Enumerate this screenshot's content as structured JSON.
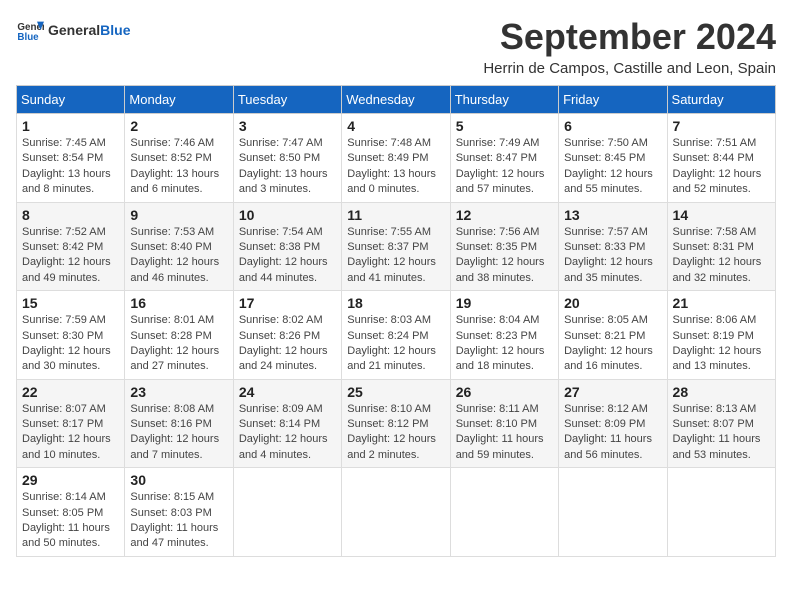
{
  "header": {
    "logo_general": "General",
    "logo_blue": "Blue",
    "month_title": "September 2024",
    "subtitle": "Herrin de Campos, Castille and Leon, Spain"
  },
  "weekdays": [
    "Sunday",
    "Monday",
    "Tuesday",
    "Wednesday",
    "Thursday",
    "Friday",
    "Saturday"
  ],
  "weeks": [
    [
      {
        "day": "1",
        "sunrise": "7:45 AM",
        "sunset": "8:54 PM",
        "daylight": "13 hours and 8 minutes."
      },
      {
        "day": "2",
        "sunrise": "7:46 AM",
        "sunset": "8:52 PM",
        "daylight": "13 hours and 6 minutes."
      },
      {
        "day": "3",
        "sunrise": "7:47 AM",
        "sunset": "8:50 PM",
        "daylight": "13 hours and 3 minutes."
      },
      {
        "day": "4",
        "sunrise": "7:48 AM",
        "sunset": "8:49 PM",
        "daylight": "13 hours and 0 minutes."
      },
      {
        "day": "5",
        "sunrise": "7:49 AM",
        "sunset": "8:47 PM",
        "daylight": "12 hours and 57 minutes."
      },
      {
        "day": "6",
        "sunrise": "7:50 AM",
        "sunset": "8:45 PM",
        "daylight": "12 hours and 55 minutes."
      },
      {
        "day": "7",
        "sunrise": "7:51 AM",
        "sunset": "8:44 PM",
        "daylight": "12 hours and 52 minutes."
      }
    ],
    [
      {
        "day": "8",
        "sunrise": "7:52 AM",
        "sunset": "8:42 PM",
        "daylight": "12 hours and 49 minutes."
      },
      {
        "day": "9",
        "sunrise": "7:53 AM",
        "sunset": "8:40 PM",
        "daylight": "12 hours and 46 minutes."
      },
      {
        "day": "10",
        "sunrise": "7:54 AM",
        "sunset": "8:38 PM",
        "daylight": "12 hours and 44 minutes."
      },
      {
        "day": "11",
        "sunrise": "7:55 AM",
        "sunset": "8:37 PM",
        "daylight": "12 hours and 41 minutes."
      },
      {
        "day": "12",
        "sunrise": "7:56 AM",
        "sunset": "8:35 PM",
        "daylight": "12 hours and 38 minutes."
      },
      {
        "day": "13",
        "sunrise": "7:57 AM",
        "sunset": "8:33 PM",
        "daylight": "12 hours and 35 minutes."
      },
      {
        "day": "14",
        "sunrise": "7:58 AM",
        "sunset": "8:31 PM",
        "daylight": "12 hours and 32 minutes."
      }
    ],
    [
      {
        "day": "15",
        "sunrise": "7:59 AM",
        "sunset": "8:30 PM",
        "daylight": "12 hours and 30 minutes."
      },
      {
        "day": "16",
        "sunrise": "8:01 AM",
        "sunset": "8:28 PM",
        "daylight": "12 hours and 27 minutes."
      },
      {
        "day": "17",
        "sunrise": "8:02 AM",
        "sunset": "8:26 PM",
        "daylight": "12 hours and 24 minutes."
      },
      {
        "day": "18",
        "sunrise": "8:03 AM",
        "sunset": "8:24 PM",
        "daylight": "12 hours and 21 minutes."
      },
      {
        "day": "19",
        "sunrise": "8:04 AM",
        "sunset": "8:23 PM",
        "daylight": "12 hours and 18 minutes."
      },
      {
        "day": "20",
        "sunrise": "8:05 AM",
        "sunset": "8:21 PM",
        "daylight": "12 hours and 16 minutes."
      },
      {
        "day": "21",
        "sunrise": "8:06 AM",
        "sunset": "8:19 PM",
        "daylight": "12 hours and 13 minutes."
      }
    ],
    [
      {
        "day": "22",
        "sunrise": "8:07 AM",
        "sunset": "8:17 PM",
        "daylight": "12 hours and 10 minutes."
      },
      {
        "day": "23",
        "sunrise": "8:08 AM",
        "sunset": "8:16 PM",
        "daylight": "12 hours and 7 minutes."
      },
      {
        "day": "24",
        "sunrise": "8:09 AM",
        "sunset": "8:14 PM",
        "daylight": "12 hours and 4 minutes."
      },
      {
        "day": "25",
        "sunrise": "8:10 AM",
        "sunset": "8:12 PM",
        "daylight": "12 hours and 2 minutes."
      },
      {
        "day": "26",
        "sunrise": "8:11 AM",
        "sunset": "8:10 PM",
        "daylight": "11 hours and 59 minutes."
      },
      {
        "day": "27",
        "sunrise": "8:12 AM",
        "sunset": "8:09 PM",
        "daylight": "11 hours and 56 minutes."
      },
      {
        "day": "28",
        "sunrise": "8:13 AM",
        "sunset": "8:07 PM",
        "daylight": "11 hours and 53 minutes."
      }
    ],
    [
      {
        "day": "29",
        "sunrise": "8:14 AM",
        "sunset": "8:05 PM",
        "daylight": "11 hours and 50 minutes."
      },
      {
        "day": "30",
        "sunrise": "8:15 AM",
        "sunset": "8:03 PM",
        "daylight": "11 hours and 47 minutes."
      },
      null,
      null,
      null,
      null,
      null
    ]
  ]
}
